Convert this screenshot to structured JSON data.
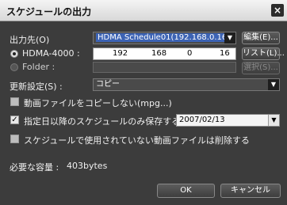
{
  "window": {
    "title": "スケジュールの出力",
    "close_glyph": "×"
  },
  "output": {
    "label": "出力先(O)",
    "selected": "HDMA Schedule01(192.168.0.16)",
    "edit_button": "編集(E)...",
    "list_button": "リスト(L)...",
    "browse_button": "選択(S)...",
    "hdma_label": "HDMA-4000 :",
    "ip": [
      "192",
      "168",
      "0",
      "16"
    ],
    "folder_label": "Folder :",
    "folder_value": ""
  },
  "update": {
    "label": "更新設定(S) :",
    "selected": "コピー"
  },
  "options": [
    {
      "label": "動画ファイルをコピーしない(mpg...)",
      "checked": false
    },
    {
      "label": "指定日以降のスケジュールのみ保存する",
      "checked": true
    },
    {
      "label": "スケジュールで使用されていない動画ファイルは削除する",
      "checked": false
    }
  ],
  "date_value": "2007/02/13",
  "required": {
    "label": "必要な容量 :",
    "value": "403bytes"
  },
  "footer": {
    "ok": "OK",
    "cancel": "キャンセル"
  }
}
